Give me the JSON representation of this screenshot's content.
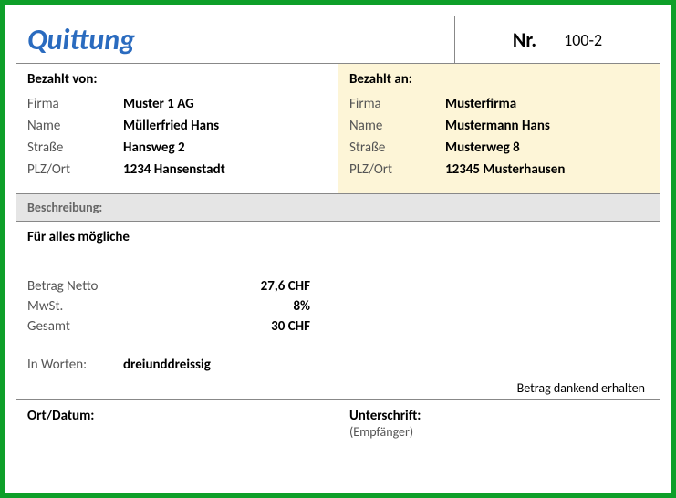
{
  "title": "Quittung",
  "number_label": "Nr.",
  "number_value": "100-2",
  "payer": {
    "header": "Bezahlt von:",
    "firma_label": "Firma",
    "firma_value": "Muster 1 AG",
    "name_label": "Name",
    "name_value": "Müllerfried Hans",
    "street_label": "Straße",
    "street_value": "Hansweg 2",
    "city_label": "PLZ/Ort",
    "city_value": "1234 Hansenstadt"
  },
  "payee": {
    "header": "Bezahlt an:",
    "firma_label": "Firma",
    "firma_value": "Musterfirma",
    "name_label": "Name",
    "name_value": "Mustermann Hans",
    "street_label": "Straße",
    "street_value": "Musterweg 8",
    "city_label": "PLZ/Ort",
    "city_value": "12345 Musterhausen"
  },
  "description_header": "Beschreibung:",
  "description_text": "Für alles mögliche",
  "amounts": {
    "net_label": "Betrag Netto",
    "net_value": "27,6 CHF",
    "vat_label": "MwSt.",
    "vat_value": "8%",
    "total_label": "Gesamt",
    "total_value": "30 CHF"
  },
  "words_label": "In Worten:",
  "words_value": "dreiunddreissig",
  "received_text": "Betrag dankend erhalten",
  "place_date_label": "Ort/Datum:",
  "signature_label": "Unterschrift:",
  "signature_sub": "(Empfänger)"
}
